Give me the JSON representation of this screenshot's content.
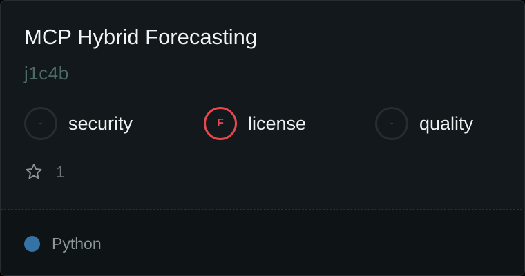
{
  "card": {
    "title": "MCP Hybrid Forecasting",
    "repo_id": "j1c4b"
  },
  "metrics": [
    {
      "grade": "-",
      "label": "security",
      "status": "none"
    },
    {
      "grade": "F",
      "label": "license",
      "status": "fail"
    },
    {
      "grade": "-",
      "label": "quality",
      "status": "none"
    }
  ],
  "stars": {
    "icon": "star-outline-icon",
    "count": "1"
  },
  "language": {
    "name": "Python",
    "color": "#3572a5"
  },
  "colors": {
    "fail": "#e5484d",
    "background": "#12181b"
  }
}
